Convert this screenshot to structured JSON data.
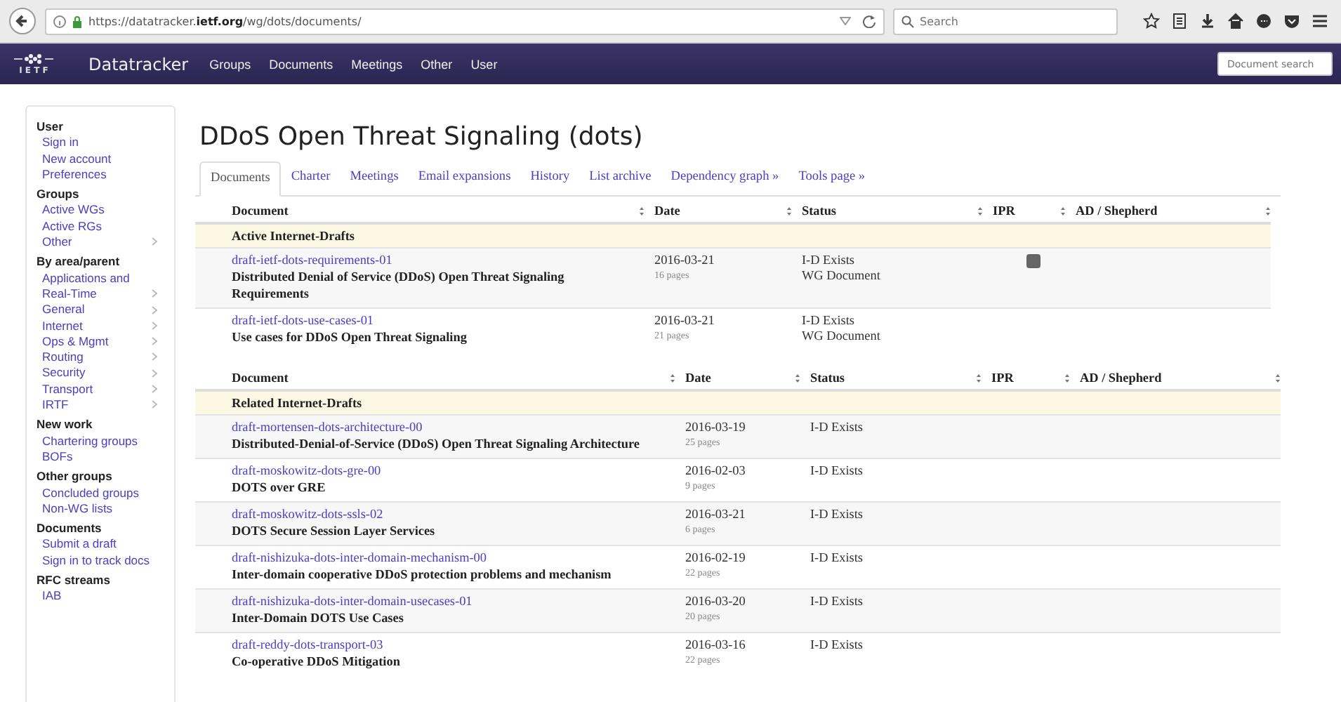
{
  "browser": {
    "url": "https://datatracker.**ietf.org**/wg/dots/documents/",
    "search": {
      "placeholder": "Search"
    }
  },
  "navbar": {
    "logo_text": "I E T F",
    "brand": "Datatracker",
    "items": [
      "Groups",
      "Documents",
      "Meetings",
      "Other",
      "User"
    ],
    "search": {
      "placeholder": "Document search"
    }
  },
  "sidebar": {
    "sections": [
      {
        "title": "User",
        "items": [
          {
            "label": "Sign in",
            "submenu": false
          },
          {
            "label": "New account",
            "submenu": false
          },
          {
            "label": "Preferences",
            "submenu": false
          }
        ]
      },
      {
        "title": "Groups",
        "items": [
          {
            "label": "Active WGs",
            "submenu": false
          },
          {
            "label": "Active RGs",
            "submenu": false
          },
          {
            "label": "Other",
            "submenu": true
          }
        ]
      },
      {
        "title": "By area/parent",
        "items": [
          {
            "label": "Applications and Real-Time",
            "submenu": true
          },
          {
            "label": "General",
            "submenu": true
          },
          {
            "label": "Internet",
            "submenu": true
          },
          {
            "label": "Ops & Mgmt",
            "submenu": true
          },
          {
            "label": "Routing",
            "submenu": true
          },
          {
            "label": "Security",
            "submenu": true
          },
          {
            "label": "Transport",
            "submenu": true
          },
          {
            "label": "IRTF",
            "submenu": true
          }
        ]
      },
      {
        "title": "New work",
        "items": [
          {
            "label": "Chartering groups",
            "submenu": false
          },
          {
            "label": "BOFs",
            "submenu": false
          }
        ]
      },
      {
        "title": "Other groups",
        "items": [
          {
            "label": "Concluded groups",
            "submenu": false
          },
          {
            "label": "Non-WG lists",
            "submenu": false
          }
        ]
      },
      {
        "title": "Documents",
        "items": [
          {
            "label": "Submit a draft",
            "submenu": false
          },
          {
            "label": "Sign in to track docs",
            "submenu": false
          }
        ]
      },
      {
        "title": "RFC streams",
        "items": [
          {
            "label": "IAB",
            "submenu": false
          }
        ]
      }
    ]
  },
  "page": {
    "title": "DDoS Open Threat Signaling (dots)",
    "tabs": [
      {
        "label": "Documents",
        "selected": true
      },
      {
        "label": "Charter",
        "selected": false
      },
      {
        "label": "Meetings",
        "selected": false
      },
      {
        "label": "Email expansions",
        "selected": false
      },
      {
        "label": "History",
        "selected": false
      },
      {
        "label": "List archive",
        "selected": false
      },
      {
        "label": "Dependency graph »",
        "selected": false
      },
      {
        "label": "Tools page »",
        "selected": false
      }
    ],
    "tables": [
      {
        "columns": [
          "Document",
          "Date",
          "Status",
          "IPR",
          "AD / Shepherd"
        ],
        "section": "Active Internet-Drafts",
        "rows": [
          {
            "name": "draft-ietf-dots-requirements-01",
            "title": "Distributed Denial of Service (DDoS) Open Threat Signaling Requirements",
            "date": "2016-03-21",
            "pages": "16 pages",
            "status": [
              "I-D Exists",
              "WG Document"
            ],
            "ipr": true
          },
          {
            "name": "draft-ietf-dots-use-cases-01",
            "title": "Use cases for DDoS Open Threat Signaling",
            "date": "2016-03-21",
            "pages": "21 pages",
            "status": [
              "I-D Exists",
              "WG Document"
            ],
            "ipr": false
          }
        ]
      },
      {
        "columns": [
          "Document",
          "Date",
          "Status",
          "IPR",
          "AD / Shepherd"
        ],
        "section": "Related Internet-Drafts",
        "rows": [
          {
            "name": "draft-mortensen-dots-architecture-00",
            "title": "Distributed-Denial-of-Service (DDoS) Open Threat Signaling Architecture",
            "date": "2016-03-19",
            "pages": "25 pages",
            "status": [
              "I-D Exists"
            ],
            "ipr": false
          },
          {
            "name": "draft-moskowitz-dots-gre-00",
            "title": "DOTS over GRE",
            "date": "2016-02-03",
            "pages": "9 pages",
            "status": [
              "I-D Exists"
            ],
            "ipr": false
          },
          {
            "name": "draft-moskowitz-dots-ssls-02",
            "title": "DOTS Secure Session Layer Services",
            "date": "2016-03-21",
            "pages": "6 pages",
            "status": [
              "I-D Exists"
            ],
            "ipr": false
          },
          {
            "name": "draft-nishizuka-dots-inter-domain-mechanism-00",
            "title": "Inter-domain cooperative DDoS protection problems and mechanism",
            "date": "2016-02-19",
            "pages": "22 pages",
            "status": [
              "I-D Exists"
            ],
            "ipr": false
          },
          {
            "name": "draft-nishizuka-dots-inter-domain-usecases-01",
            "title": "Inter-Domain DOTS Use Cases",
            "date": "2016-03-20",
            "pages": "20 pages",
            "status": [
              "I-D Exists"
            ],
            "ipr": false
          },
          {
            "name": "draft-reddy-dots-transport-03",
            "title": "Co-operative DDoS Mitigation",
            "date": "2016-03-16",
            "pages": "22 pages",
            "status": [
              "I-D Exists"
            ],
            "ipr": false
          }
        ]
      }
    ]
  }
}
